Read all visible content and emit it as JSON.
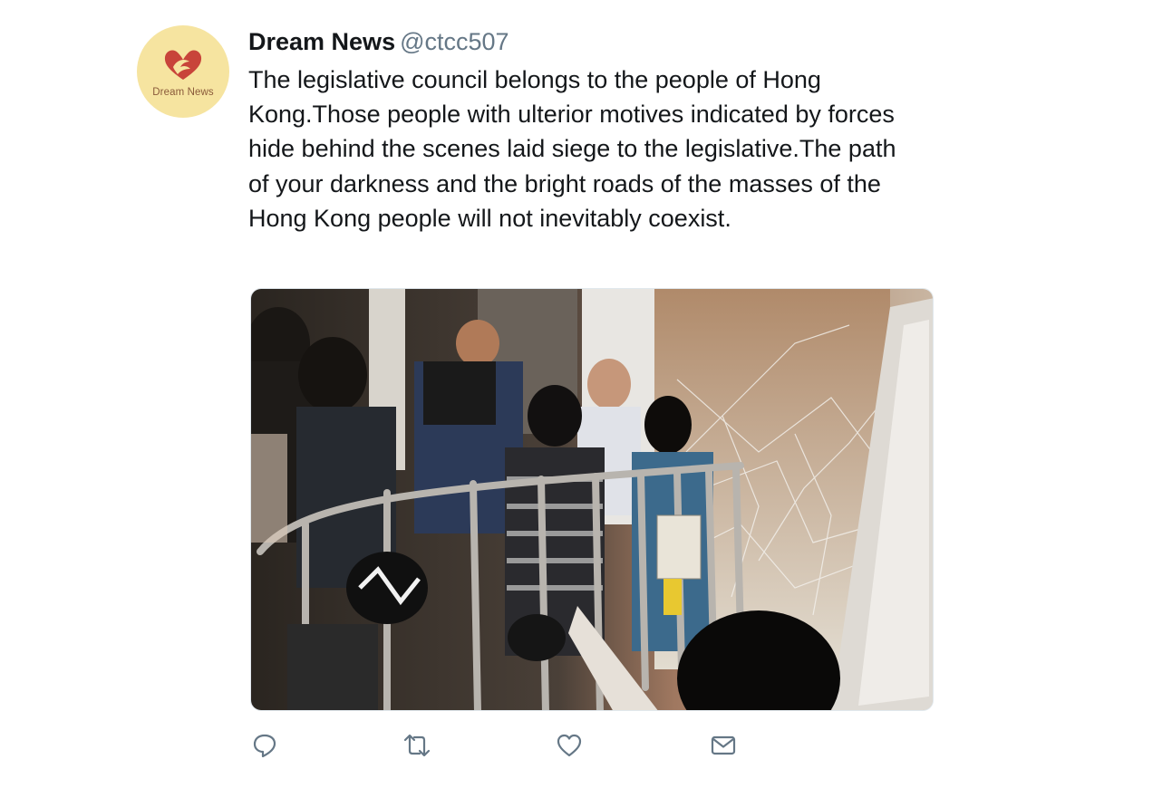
{
  "tweet": {
    "display_name": "Dream News",
    "handle": "@ctcc507",
    "avatar_label": "Dream News",
    "text": "The legislative council belongs to the people of Hong Kong.Those people with ulterior motives indicated by forces hide behind the scenes laid siege to the legislative.The path of your darkness and the bright roads of the masses of the Hong Kong people will not inevitably coexist."
  },
  "actions": {
    "reply_icon": "reply-icon",
    "retweet_icon": "retweet-icon",
    "like_icon": "heart-icon",
    "message_icon": "envelope-icon"
  },
  "colors": {
    "avatar_bg": "#f6e4a0",
    "logo_red": "#c8443a",
    "name": "#14171a",
    "handle": "#657786",
    "icon": "#657786"
  }
}
